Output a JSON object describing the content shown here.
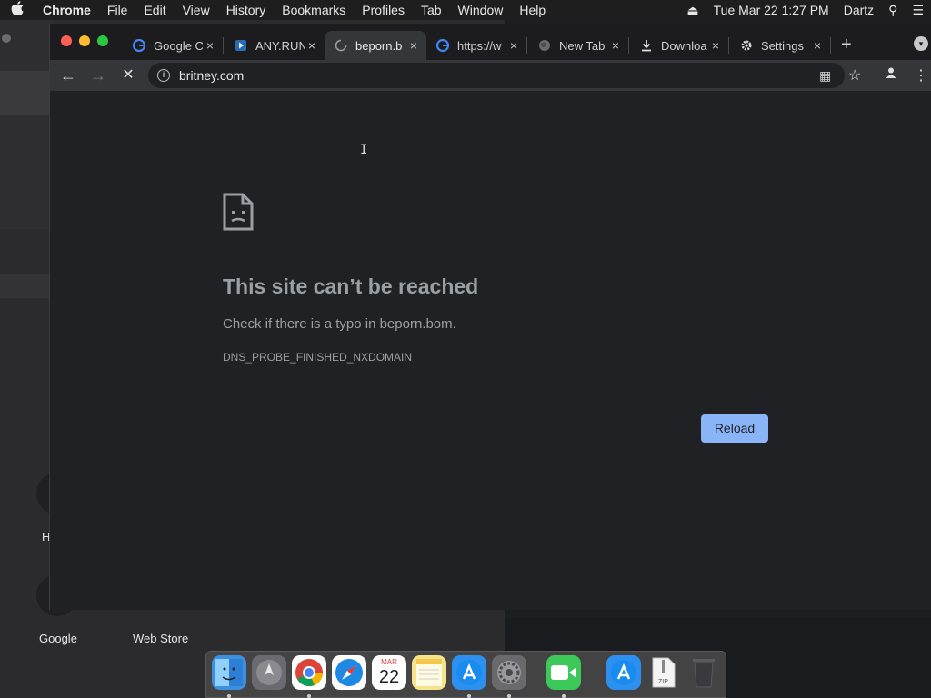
{
  "menubar": {
    "apple": "",
    "app": "Chrome",
    "items": [
      "File",
      "Edit",
      "View",
      "History",
      "Bookmarks",
      "Profiles",
      "Tab",
      "Window",
      "Help"
    ],
    "clock": "Tue Mar 22  1:27 PM",
    "user": "Dartz",
    "eject_icon": "⏏",
    "search_icon": "⚲",
    "list_icon": "☰"
  },
  "desktop": {
    "labels": [
      "Google",
      "Web Store"
    ],
    "partial_label": "H"
  },
  "tabs": [
    {
      "title": "Google C",
      "icon": "G",
      "icon_color": "#4285f4"
    },
    {
      "title": "ANY.RUN",
      "icon": "▷",
      "icon_color": "#4a90e2"
    },
    {
      "title": "beporn.b",
      "icon": "◔",
      "icon_color": "#9a9a9a"
    },
    {
      "title": "https://w",
      "icon": "G",
      "icon_color": "#4285f4"
    },
    {
      "title": "New Tab",
      "icon": "🌐",
      "icon_color": "#9a9a9a"
    },
    {
      "title": "Downloa",
      "icon": "⬇",
      "icon_color": "#e0e0e0"
    },
    {
      "title": "Settings",
      "icon": "⚙",
      "icon_color": "#e0e0e0"
    }
  ],
  "tab_close": "×",
  "new_tab": "+",
  "toolbar": {
    "back": "←",
    "forward": "→",
    "stop": "✕",
    "url": "britney.com",
    "info_icon": "i",
    "qr_icon": "▦",
    "star_icon": "☆",
    "profile_icon": "●",
    "menu_icon": "⋮"
  },
  "error": {
    "title": "This site can’t be reached",
    "message": "Check if there is a typo in beporn.bom.",
    "code": "DNS_PROBE_FINISHED_NXDOMAIN",
    "reload": "Reload"
  },
  "dock": {
    "items": [
      {
        "name": "finder",
        "glyph": "☺",
        "color": "#4a9ef0"
      },
      {
        "name": "launchpad",
        "glyph": "🚀",
        "color": "#7a7a80"
      },
      {
        "name": "chrome",
        "glyph": "◉",
        "color": "#ffffff"
      },
      {
        "name": "safari",
        "glyph": "✦",
        "color": "#2d8ff0"
      },
      {
        "name": "calendar",
        "glyph": "22",
        "color": "#ffffff",
        "month": "MAR"
      },
      {
        "name": "notes",
        "glyph": "≡",
        "color": "#f7e38a"
      },
      {
        "name": "app-store",
        "glyph": "A",
        "color": "#3ba3f5"
      },
      {
        "name": "system-preferences",
        "glyph": "⚙",
        "color": "#8a8a8e"
      },
      {
        "name": "facetime",
        "glyph": "▶",
        "color": "#3cc95a"
      },
      {
        "name": "app-store-2",
        "glyph": "A",
        "color": "#3ba3f5"
      },
      {
        "name": "archive",
        "glyph": "ZIP",
        "color": "#e8e8e8"
      },
      {
        "name": "trash",
        "glyph": "🗑",
        "color": "#5a5a5c"
      }
    ]
  }
}
